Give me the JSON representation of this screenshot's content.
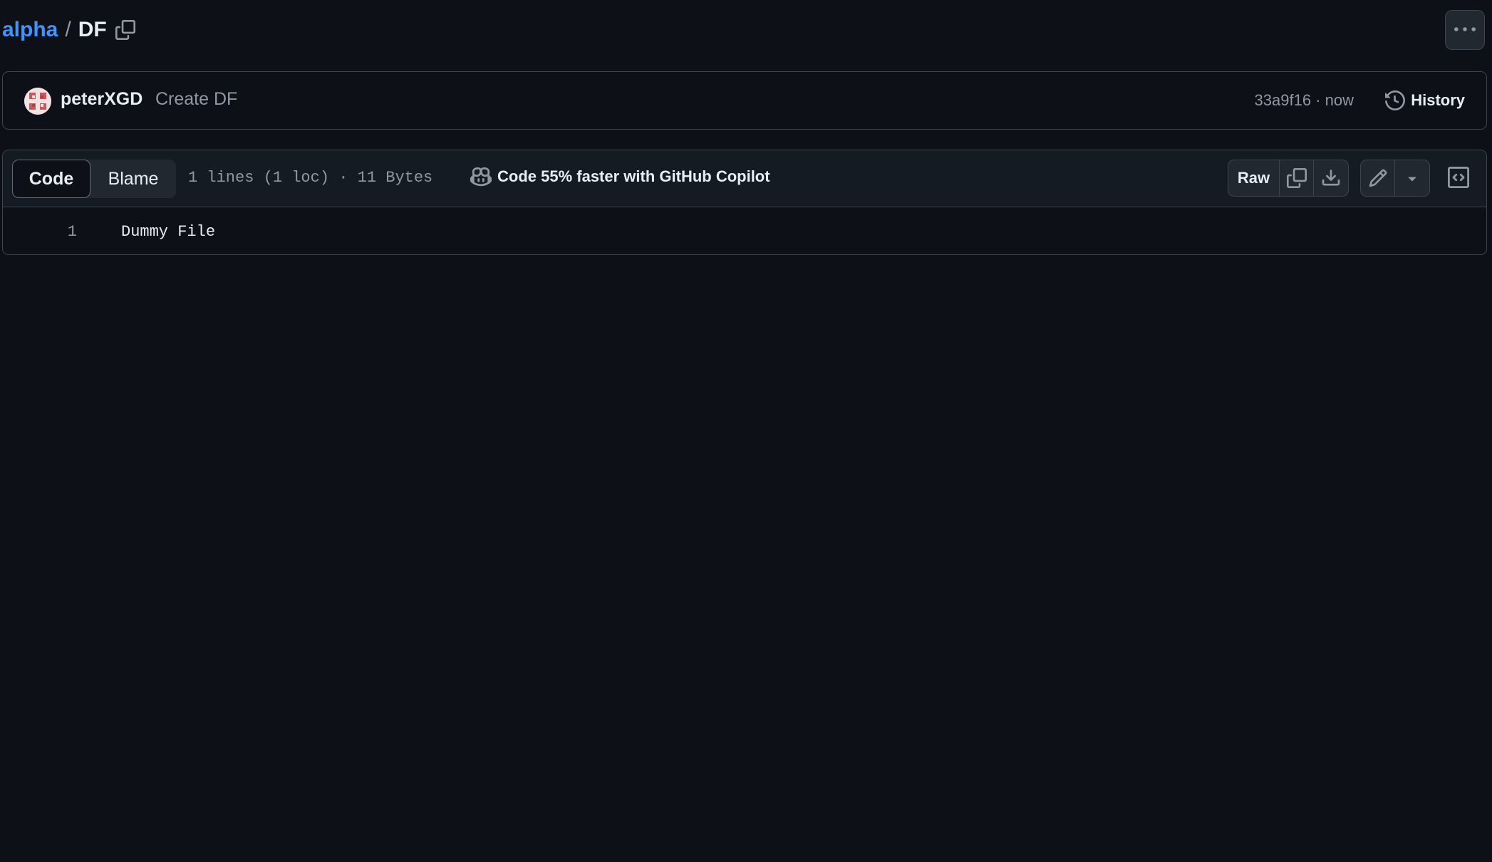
{
  "breadcrumb": {
    "repo": "alpha",
    "separator": "/",
    "file": "DF"
  },
  "commit": {
    "author": "peterXGD",
    "message": "Create DF",
    "sha": "33a9f16",
    "meta_separator": " · ",
    "time": "now",
    "history_label": "History"
  },
  "file_toolbar": {
    "tabs": [
      {
        "label": "Code",
        "active": true
      },
      {
        "label": "Blame",
        "active": false
      }
    ],
    "file_info": "1 lines (1 loc) · 11 Bytes",
    "copilot_text": "Code 55% faster with GitHub Copilot",
    "raw_label": "Raw"
  },
  "code": {
    "lines": [
      {
        "number": "1",
        "text": "Dummy File"
      }
    ]
  },
  "icons": {
    "copy_path": "copy-icon",
    "more": "kebab-horizontal-icon",
    "history": "history-icon",
    "copilot": "copilot-icon",
    "copy_raw": "copy-icon",
    "download": "download-icon",
    "edit": "pencil-icon",
    "dropdown": "triangle-down-icon",
    "symbols": "code-square-icon"
  },
  "colors": {
    "background": "#0d1117",
    "link": "#4493f8",
    "muted": "#9198a1",
    "border": "#3d444d"
  }
}
